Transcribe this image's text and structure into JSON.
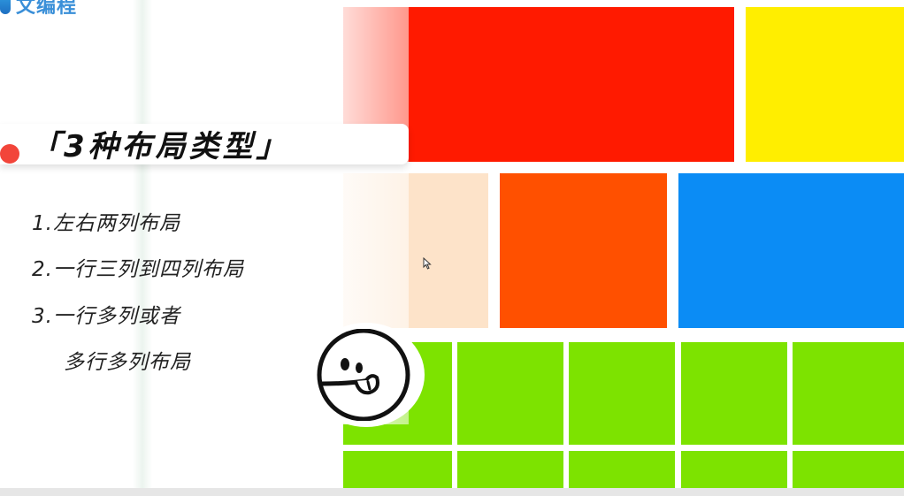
{
  "logo": {
    "text": "文编程",
    "color": "#3a8fd8"
  },
  "title": {
    "text": "「3种布局类型」",
    "dot_color": "#f2453a"
  },
  "list": {
    "item1": "1.左右两列布局",
    "item2": "2.一行三列到四列布局",
    "item3_line1": "3.一行多列或者",
    "item3_line2": "多行多列布局"
  },
  "colors": {
    "red": "#ff1a00",
    "yellow": "#ffee00",
    "peach": "#fde3c9",
    "orange": "#ff5000",
    "blue": "#0b8cf5",
    "green": "#7de300"
  },
  "icons": {
    "mascot": "smiley-face-icon",
    "cursor": "mouse-pointer-icon"
  }
}
